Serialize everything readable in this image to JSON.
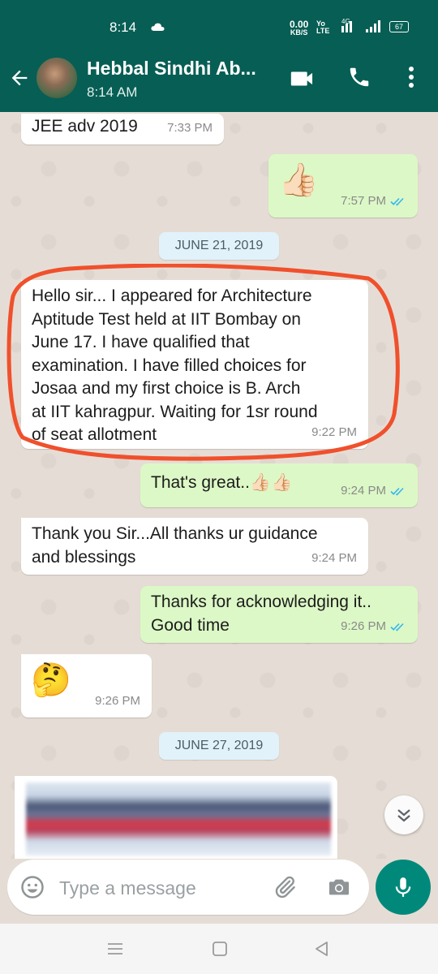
{
  "status": {
    "time": "8:14",
    "speed_value": "0.00",
    "speed_unit": "KB/S",
    "volte_top": "Yo",
    "volte_bottom": "LTE",
    "network": "4G",
    "battery": "67"
  },
  "header": {
    "contact_name": "Hebbal Sindhi Ab...",
    "subtitle": "8:14 AM"
  },
  "messages": [
    {
      "dir": "in",
      "text": "JEE adv 2019",
      "time": "7:33 PM"
    },
    {
      "dir": "out",
      "emoji": "👍🏻",
      "time": "7:57 PM"
    },
    {
      "dir": "in",
      "text": "Hello sir... I appeared for Architecture\nAptitude Test held at IIT Bombay on\nJune 17. I have qualified that\nexamination. I have filled choices for\nJosaa and my first choice is B. Arch\nat IIT kahragpur. Waiting for 1sr round\nof seat allotment",
      "time": "9:22 PM"
    },
    {
      "dir": "out",
      "text": "That's great..👍🏻👍🏻",
      "time": "9:24 PM"
    },
    {
      "dir": "in",
      "text": "Thank you Sir...All thanks ur guidance\nand blessings",
      "time": "9:24 PM"
    },
    {
      "dir": "out",
      "text": "Thanks for acknowledging it..\nGood time",
      "time": "9:26 PM"
    },
    {
      "dir": "in",
      "emoji": "🤔",
      "time": "9:26 PM"
    }
  ],
  "date_chips": [
    "JUNE 21, 2019",
    "JUNE 27, 2019"
  ],
  "composer": {
    "placeholder": "Type a message"
  },
  "colors": {
    "header": "#075e54",
    "outgoing": "#dcf8c6",
    "incoming": "#ffffff",
    "tick": "#34b7f1",
    "mic": "#00897b",
    "highlight": "#f0502c"
  },
  "icons": {
    "back": "arrow-left-icon",
    "video": "video-call-icon",
    "call": "phone-icon",
    "menu": "more-vert-icon",
    "emoji": "emoji-icon",
    "attach": "paperclip-icon",
    "camera": "camera-icon",
    "mic": "mic-icon"
  }
}
